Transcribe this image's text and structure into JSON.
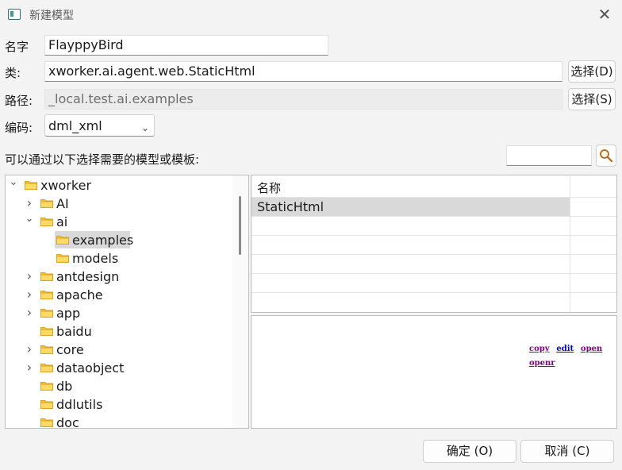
{
  "window": {
    "title": "新建模型",
    "close_glyph": "✕"
  },
  "form": {
    "name_label": "名字",
    "name_value": "FlayppyBird",
    "class_label": "类:",
    "class_value": "xworker.ai.agent.web.StaticHtml",
    "class_button": "选择(D)",
    "path_label": "路径:",
    "path_value": "_local.test.ai.examples",
    "path_button": "选择(S)",
    "encoding_label": "编码:",
    "encoding_value": "dml_xml",
    "choose_label": "可以通过以下选择需要的模型或模板:",
    "search_value": ""
  },
  "tree": {
    "items": [
      {
        "label": "xworker",
        "level": 0,
        "arrow": "⌄",
        "selected": false
      },
      {
        "label": "AI",
        "level": 1,
        "arrow": "›",
        "selected": false
      },
      {
        "label": "ai",
        "level": 1,
        "arrow": "⌄",
        "selected": false
      },
      {
        "label": "examples",
        "level": 2,
        "arrow": "",
        "selected": true
      },
      {
        "label": "models",
        "level": 2,
        "arrow": "",
        "selected": false
      },
      {
        "label": "antdesign",
        "level": 1,
        "arrow": "›",
        "selected": false
      },
      {
        "label": "apache",
        "level": 1,
        "arrow": "›",
        "selected": false
      },
      {
        "label": "app",
        "level": 1,
        "arrow": "›",
        "selected": false
      },
      {
        "label": "baidu",
        "level": 1,
        "arrow": "",
        "selected": false
      },
      {
        "label": "core",
        "level": 1,
        "arrow": "›",
        "selected": false
      },
      {
        "label": "dataobject",
        "level": 1,
        "arrow": "›",
        "selected": false
      },
      {
        "label": "db",
        "level": 1,
        "arrow": "",
        "selected": false
      },
      {
        "label": "ddlutils",
        "level": 1,
        "arrow": "",
        "selected": false
      },
      {
        "label": "doc",
        "level": 1,
        "arrow": "",
        "selected": false
      }
    ]
  },
  "table": {
    "header": "名称",
    "rows": [
      "StaticHtml"
    ]
  },
  "preview": {
    "links": [
      {
        "label": "copy",
        "color": "#800080"
      },
      {
        "label": "edit",
        "color": "#0000cc"
      },
      {
        "label": "open",
        "color": "#800080"
      },
      {
        "label": "openr",
        "color": "#800080"
      }
    ]
  },
  "footer": {
    "ok_label": "确定 (O)",
    "cancel_label": "取消 (C)"
  },
  "colors": {
    "folder": "#f5c542",
    "selection": "#d9d9d9"
  }
}
